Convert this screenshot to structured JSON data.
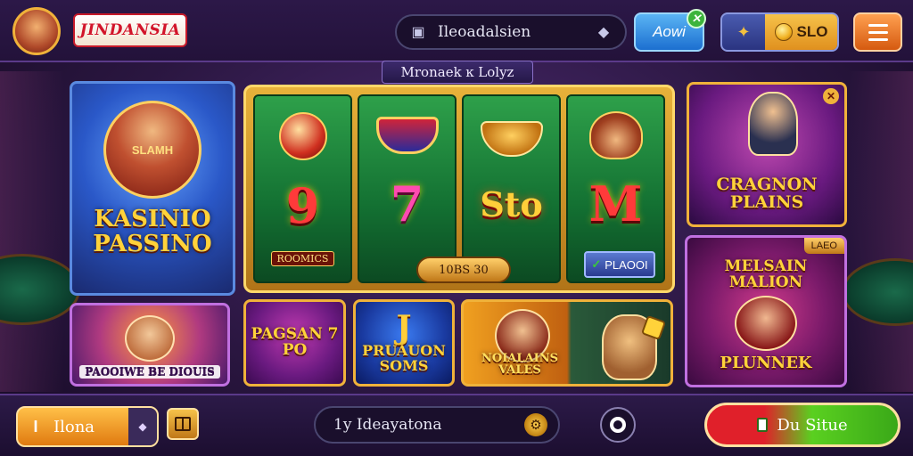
{
  "header": {
    "logo_text": "JINDANSIA",
    "search_text": "Ileoadalsien",
    "now_button": "Aowi",
    "now_badge": "✕",
    "wallet_label": "SLO",
    "banner_title": "Mronaek ĸ Lolyz"
  },
  "left_cards": {
    "main_small_text": "SLAMH",
    "main_title": "KASINIO PASSINO",
    "sub_title": "PAOOIWE BE DIOUIS"
  },
  "slot": {
    "reels": [
      {
        "big": "9",
        "caption": "ROOMICS"
      },
      {
        "big": "7",
        "caption": ""
      },
      {
        "big": "Sto",
        "caption": ""
      },
      {
        "big": "M",
        "caption": ""
      }
    ],
    "bet_label": "10BS 30",
    "info_label": "PLAOOI"
  },
  "row_cards": [
    {
      "title": "PAGSAN 7 PO"
    },
    {
      "num": "J",
      "title": "PRUAUON SOMS"
    },
    {
      "title": "NOIALAINS VALES"
    }
  ],
  "right_cards": {
    "top_title": "CRAGNON PLAINS",
    "bottom_tag": "LAEO",
    "bottom_top_title": "MELSAIN MALION",
    "bottom_title": "PLUNNEK"
  },
  "footer": {
    "home_label": "Ilona",
    "home_icon": "I",
    "search_text": "1y Ideayatona",
    "go_label": "Du Situe"
  },
  "colors": {
    "accent": "#f0b23a",
    "background": "#2a1640",
    "go_green": "#3aa818",
    "go_red": "#e0202a"
  }
}
